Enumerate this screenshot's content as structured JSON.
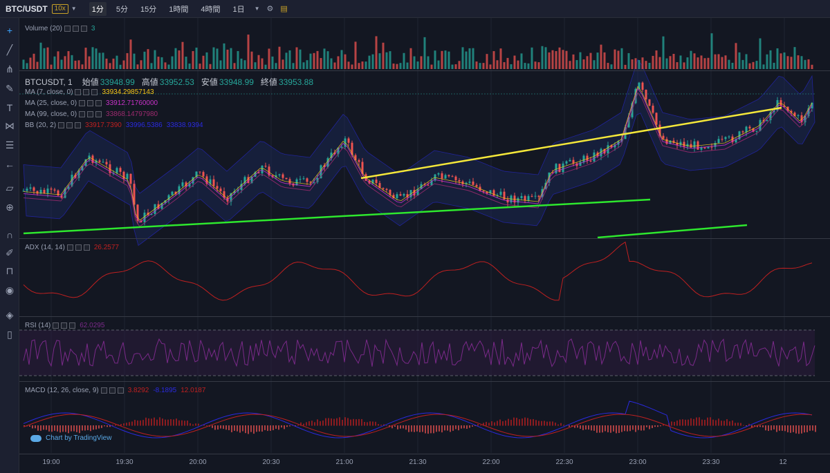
{
  "toolbar": {
    "symbol": "BTC/USDT",
    "leverage": "10x",
    "timeframes": [
      "1分",
      "5分",
      "15分",
      "1時間",
      "4時間",
      "1日"
    ],
    "active_timeframe": "1分"
  },
  "sidebar": {
    "tools": [
      "crosshair-icon",
      "trendline-icon",
      "pitchfork-icon",
      "brush-icon",
      "text-icon",
      "pattern-icon",
      "fibonacci-icon",
      "arrow-back-icon",
      "ruler-icon",
      "zoom-in-icon",
      "magnet-icon",
      "lock-drawing-icon",
      "unlock-icon",
      "eye-icon",
      "layers-icon",
      "trash-icon"
    ]
  },
  "volume": {
    "label": "Volume (20)",
    "value": "3"
  },
  "main": {
    "symbol": "BTCUSDT, 1",
    "open_label": "始値",
    "open": "33948.99",
    "high_label": "高値",
    "high": "33952.53",
    "low_label": "安値",
    "low": "33948.99",
    "close_label": "終値",
    "close": "33953.88"
  },
  "indicators": {
    "ma7": {
      "label": "MA (7, close, 0)",
      "value": "33934.29857143",
      "color": "#f5c518"
    },
    "ma25": {
      "label": "MA (25, close, 0)",
      "value": "33912.71760000",
      "color": "#c832c8"
    },
    "ma99": {
      "label": "MA (99, close, 0)",
      "value": "33868.14797980",
      "color": "#9c2a6e"
    },
    "bb": {
      "label": "BB (20, 2)",
      "value": "33917.7390",
      "value2": "33996.5386",
      "value3": "33838.9394",
      "color": "#c02020"
    },
    "adx": {
      "label": "ADX (14, 14)",
      "value": "26.2577",
      "color": "#c02020"
    },
    "rsi": {
      "label": "RSI (14)",
      "value": "62.0295",
      "color": "#7b2a8a"
    },
    "macd": {
      "label": "MACD (12, 26, close, 9)",
      "v1": "3.8292",
      "v2": "-8.1895",
      "v3": "12.0187",
      "color1": "#c02020",
      "color2": "#2a2ae0"
    }
  },
  "badge": {
    "text": "Chart by TradingView"
  },
  "time_axis": [
    "19:00",
    "19:30",
    "20:00",
    "20:30",
    "21:00",
    "21:30",
    "22:00",
    "22:30",
    "23:00",
    "23:30",
    "12"
  ],
  "colors": {
    "up": "#26a69a",
    "down": "#ef5350",
    "trend_yellow": "#f5e83a",
    "trend_green": "#2ee82e"
  },
  "chart_data": {
    "type": "line",
    "title": "BTCUSDT, 1",
    "x": [
      "19:00",
      "19:30",
      "20:00",
      "20:30",
      "21:00",
      "21:30",
      "22:00",
      "22:30",
      "23:00",
      "23:30",
      "12"
    ],
    "series": [
      {
        "name": "MA (7, close, 0)",
        "values": [
          33872,
          33852,
          33876,
          33895,
          33905,
          33868,
          33880,
          33895,
          33935,
          33920,
          33934
        ]
      },
      {
        "name": "MA (25, close, 0)",
        "values": [
          33870,
          33860,
          33868,
          33885,
          33895,
          33875,
          33874,
          33885,
          33912,
          33910,
          33912
        ]
      },
      {
        "name": "MA (99, close, 0)",
        "values": [
          33862,
          33860,
          33862,
          33868,
          33872,
          33870,
          33866,
          33862,
          33868,
          33868,
          33868
        ]
      }
    ],
    "ylim": [
      33820,
      33960
    ]
  }
}
